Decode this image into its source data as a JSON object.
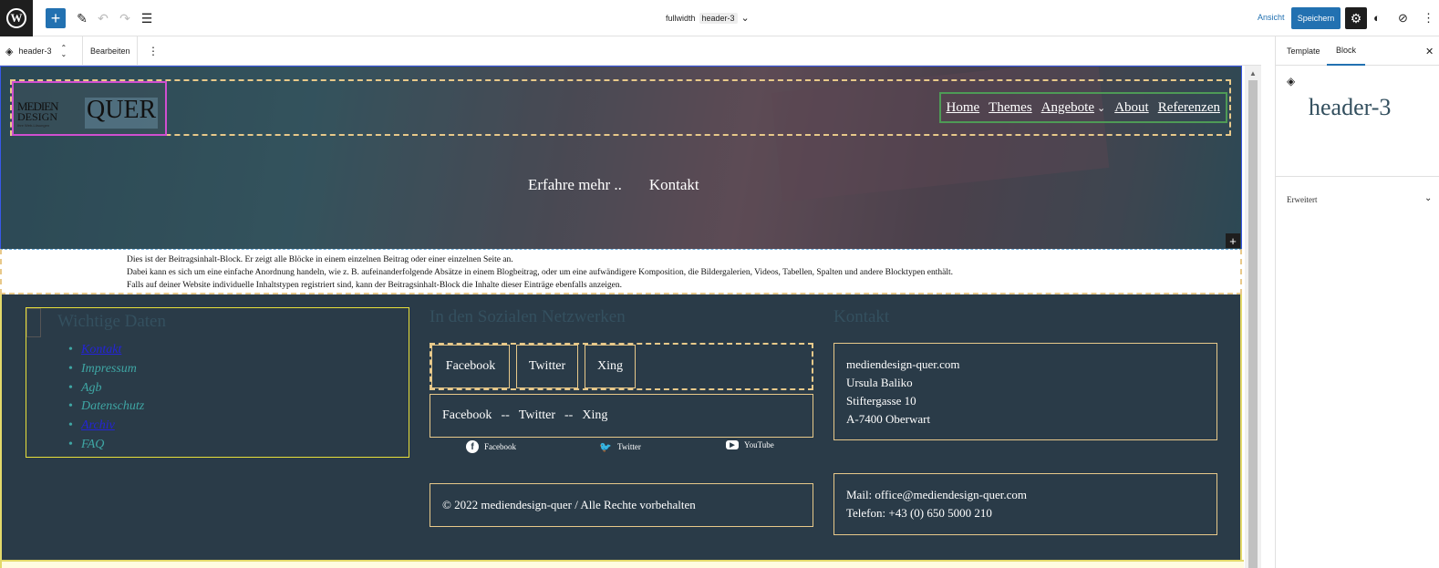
{
  "topbar": {
    "logo_glyph": "W",
    "add_glyph": "+",
    "pen_glyph": "✎",
    "undo_glyph": "↶",
    "redo_glyph": "↷",
    "listview_glyph": "☰",
    "template_name": "fullwidth",
    "part_tag": "header-3",
    "chevron": "⌄",
    "view_label": "Ansicht",
    "save_label": "Speichern",
    "settings_glyph": "⚙",
    "style_glyph": "◐",
    "compass_glyph": "⊘",
    "more_glyph": "⋮"
  },
  "blocktoolbar": {
    "part_label": "header-3",
    "edit_label": "Bearbeiten",
    "more_glyph": "⋮",
    "updown_glyph": "⌃⌄"
  },
  "header": {
    "logo_line1": "MEDIEN",
    "logo_line2": "DESIGN",
    "logo_quer": "QUER",
    "logo_tagline": "Ihre Web-Lösungen",
    "nav": [
      "Home",
      "Themes",
      "Angebote",
      "About",
      "Referenzen"
    ],
    "nav_chevron": "⌄"
  },
  "hero": {
    "link1": "Erfahre mehr ..",
    "link2": "Kontakt",
    "plus_glyph": "+"
  },
  "post_content": {
    "line1": "Dies ist der Beitragsinhalt-Block. Er zeigt alle Blöcke in einem einzelnen Beitrag oder einer einzelnen Seite an.",
    "line2": "Dabei kann es sich um eine einfache Anordnung handeln, wie z. B. aufeinanderfolgende Absätze in einem Blogbeitrag, oder um eine aufwändigere Komposition, die Bildergalerien, Videos, Tabellen, Spalten und andere Blocktypen enthält.",
    "line3": "Falls auf deiner Website individuelle Inhaltstypen registriert sind, kann der Beitragsinhalt-Block die Inhalte dieser Einträge ebenfalls anzeigen."
  },
  "footer": {
    "col1_heading": "Wichtige Daten",
    "col1_items": [
      "Kontakt",
      "Impressum",
      "Agb",
      "Datenschutz",
      "Archiv",
      "FAQ"
    ],
    "col2_heading": "In den Sozialen Netzwerken",
    "social_buttons": [
      "Facebook",
      "Twitter",
      "Xing"
    ],
    "social_plain": [
      "Facebook",
      "--",
      "Twitter",
      "--",
      "Xing"
    ],
    "social_icons": [
      {
        "icon": "facebook-icon",
        "glyph": "f",
        "label": "Facebook"
      },
      {
        "icon": "twitter-icon",
        "glyph": "🐦",
        "label": "Twitter"
      },
      {
        "icon": "youtube-icon",
        "glyph": "▶",
        "label": "YouTube"
      }
    ],
    "copyright": "© 2022 mediendesign-quer / Alle Rechte vorbehalten",
    "col3_heading": "Kontakt",
    "address": [
      "mediendesign-quer.com",
      "Ursula Baliko",
      "Stiftergasse 10",
      "A-7400 Oberwart"
    ],
    "contact": [
      "Mail: office@mediendesign-quer.com",
      "Telefon: +43 (0) 650 5000 210"
    ]
  },
  "sidebar": {
    "tab_template": "Template",
    "tab_block": "Block",
    "close_glyph": "✕",
    "block_icon": "◈",
    "block_title": "header-3",
    "advanced_label": "Erweitert",
    "advanced_chevron": "⌄"
  },
  "colors": {
    "accent": "#2271b1",
    "footer_bg": "#2a3b48",
    "heading": "#34505f",
    "link_teal": "#3fa6a4",
    "border_gold": "#e8c98a"
  }
}
